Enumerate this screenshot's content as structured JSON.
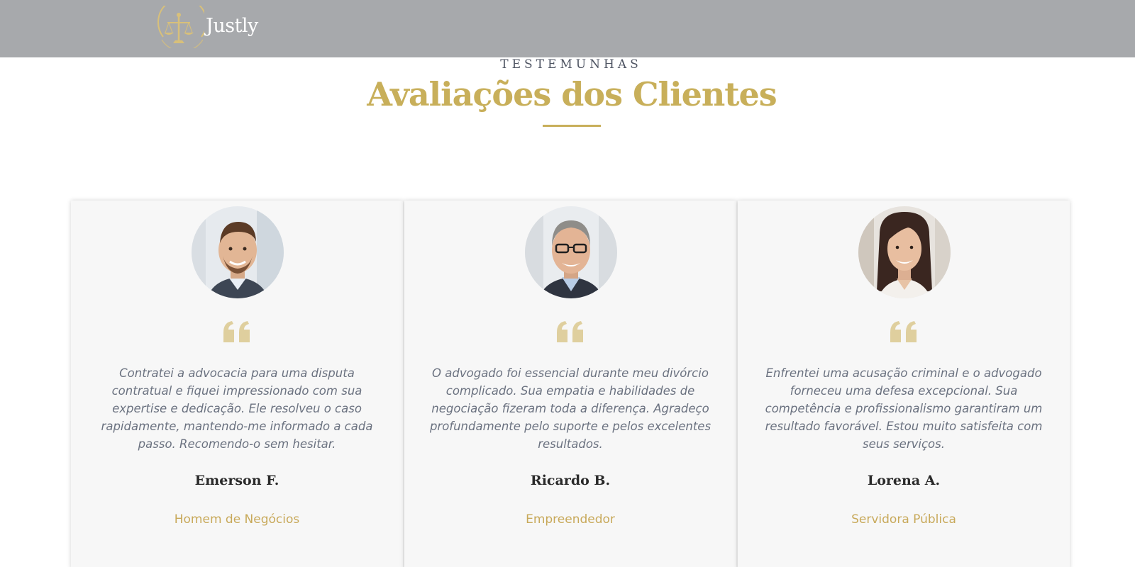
{
  "header": {
    "brand_name": "Justly",
    "background_color": "#a7a9ac",
    "logo_icon": "scales-of-justice-icon"
  },
  "section": {
    "eyebrow": "TESTEMUNHAS",
    "title": "Avaliações dos Clientes",
    "accent_color": "#c8af5a"
  },
  "testimonials": [
    {
      "avatar_icon": "client-photo-man",
      "quote_icon": "quote-icon",
      "text": "Contratei a advocacia para uma disputa contratual e fiquei impressionado com sua expertise e dedicação. Ele resolveu o caso rapidamente, mantendo-me informado a cada passo. Recomendo-o sem hesitar.",
      "name": "Emerson F.",
      "role": "Homem de Negócios"
    },
    {
      "avatar_icon": "client-photo-man-glasses",
      "quote_icon": "quote-icon",
      "text": "O advogado foi essencial durante meu divórcio complicado. Sua empatia e habilidades de negociação fizeram toda a diferença. Agradeço profundamente pelo suporte e pelos excelentes resultados.",
      "name": "Ricardo B.",
      "role": "Empreendedor"
    },
    {
      "avatar_icon": "client-photo-woman",
      "quote_icon": "quote-icon",
      "text": "Enfrentei uma acusação criminal e o advogado forneceu uma defesa excepcional. Sua competência e profissionalismo garantiram um resultado favorável. Estou muito satisfeita com seus serviços.",
      "name": "Lorena A.",
      "role": "Servidora Pública"
    }
  ]
}
